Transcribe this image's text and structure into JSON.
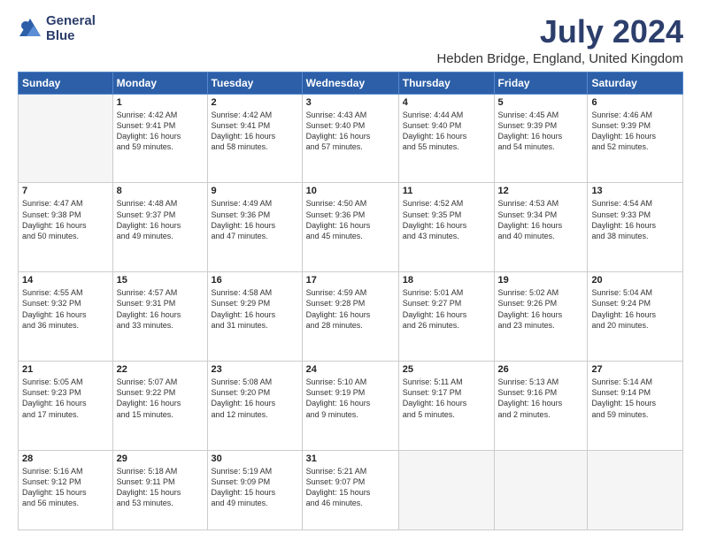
{
  "logo": {
    "line1": "General",
    "line2": "Blue"
  },
  "title": "July 2024",
  "location": "Hebden Bridge, England, United Kingdom",
  "weekdays": [
    "Sunday",
    "Monday",
    "Tuesday",
    "Wednesday",
    "Thursday",
    "Friday",
    "Saturday"
  ],
  "weeks": [
    [
      {
        "day": "",
        "info": ""
      },
      {
        "day": "1",
        "info": "Sunrise: 4:42 AM\nSunset: 9:41 PM\nDaylight: 16 hours\nand 59 minutes."
      },
      {
        "day": "2",
        "info": "Sunrise: 4:42 AM\nSunset: 9:41 PM\nDaylight: 16 hours\nand 58 minutes."
      },
      {
        "day": "3",
        "info": "Sunrise: 4:43 AM\nSunset: 9:40 PM\nDaylight: 16 hours\nand 57 minutes."
      },
      {
        "day": "4",
        "info": "Sunrise: 4:44 AM\nSunset: 9:40 PM\nDaylight: 16 hours\nand 55 minutes."
      },
      {
        "day": "5",
        "info": "Sunrise: 4:45 AM\nSunset: 9:39 PM\nDaylight: 16 hours\nand 54 minutes."
      },
      {
        "day": "6",
        "info": "Sunrise: 4:46 AM\nSunset: 9:39 PM\nDaylight: 16 hours\nand 52 minutes."
      }
    ],
    [
      {
        "day": "7",
        "info": "Sunrise: 4:47 AM\nSunset: 9:38 PM\nDaylight: 16 hours\nand 50 minutes."
      },
      {
        "day": "8",
        "info": "Sunrise: 4:48 AM\nSunset: 9:37 PM\nDaylight: 16 hours\nand 49 minutes."
      },
      {
        "day": "9",
        "info": "Sunrise: 4:49 AM\nSunset: 9:36 PM\nDaylight: 16 hours\nand 47 minutes."
      },
      {
        "day": "10",
        "info": "Sunrise: 4:50 AM\nSunset: 9:36 PM\nDaylight: 16 hours\nand 45 minutes."
      },
      {
        "day": "11",
        "info": "Sunrise: 4:52 AM\nSunset: 9:35 PM\nDaylight: 16 hours\nand 43 minutes."
      },
      {
        "day": "12",
        "info": "Sunrise: 4:53 AM\nSunset: 9:34 PM\nDaylight: 16 hours\nand 40 minutes."
      },
      {
        "day": "13",
        "info": "Sunrise: 4:54 AM\nSunset: 9:33 PM\nDaylight: 16 hours\nand 38 minutes."
      }
    ],
    [
      {
        "day": "14",
        "info": "Sunrise: 4:55 AM\nSunset: 9:32 PM\nDaylight: 16 hours\nand 36 minutes."
      },
      {
        "day": "15",
        "info": "Sunrise: 4:57 AM\nSunset: 9:31 PM\nDaylight: 16 hours\nand 33 minutes."
      },
      {
        "day": "16",
        "info": "Sunrise: 4:58 AM\nSunset: 9:29 PM\nDaylight: 16 hours\nand 31 minutes."
      },
      {
        "day": "17",
        "info": "Sunrise: 4:59 AM\nSunset: 9:28 PM\nDaylight: 16 hours\nand 28 minutes."
      },
      {
        "day": "18",
        "info": "Sunrise: 5:01 AM\nSunset: 9:27 PM\nDaylight: 16 hours\nand 26 minutes."
      },
      {
        "day": "19",
        "info": "Sunrise: 5:02 AM\nSunset: 9:26 PM\nDaylight: 16 hours\nand 23 minutes."
      },
      {
        "day": "20",
        "info": "Sunrise: 5:04 AM\nSunset: 9:24 PM\nDaylight: 16 hours\nand 20 minutes."
      }
    ],
    [
      {
        "day": "21",
        "info": "Sunrise: 5:05 AM\nSunset: 9:23 PM\nDaylight: 16 hours\nand 17 minutes."
      },
      {
        "day": "22",
        "info": "Sunrise: 5:07 AM\nSunset: 9:22 PM\nDaylight: 16 hours\nand 15 minutes."
      },
      {
        "day": "23",
        "info": "Sunrise: 5:08 AM\nSunset: 9:20 PM\nDaylight: 16 hours\nand 12 minutes."
      },
      {
        "day": "24",
        "info": "Sunrise: 5:10 AM\nSunset: 9:19 PM\nDaylight: 16 hours\nand 9 minutes."
      },
      {
        "day": "25",
        "info": "Sunrise: 5:11 AM\nSunset: 9:17 PM\nDaylight: 16 hours\nand 5 minutes."
      },
      {
        "day": "26",
        "info": "Sunrise: 5:13 AM\nSunset: 9:16 PM\nDaylight: 16 hours\nand 2 minutes."
      },
      {
        "day": "27",
        "info": "Sunrise: 5:14 AM\nSunset: 9:14 PM\nDaylight: 15 hours\nand 59 minutes."
      }
    ],
    [
      {
        "day": "28",
        "info": "Sunrise: 5:16 AM\nSunset: 9:12 PM\nDaylight: 15 hours\nand 56 minutes."
      },
      {
        "day": "29",
        "info": "Sunrise: 5:18 AM\nSunset: 9:11 PM\nDaylight: 15 hours\nand 53 minutes."
      },
      {
        "day": "30",
        "info": "Sunrise: 5:19 AM\nSunset: 9:09 PM\nDaylight: 15 hours\nand 49 minutes."
      },
      {
        "day": "31",
        "info": "Sunrise: 5:21 AM\nSunset: 9:07 PM\nDaylight: 15 hours\nand 46 minutes."
      },
      {
        "day": "",
        "info": ""
      },
      {
        "day": "",
        "info": ""
      },
      {
        "day": "",
        "info": ""
      }
    ]
  ]
}
